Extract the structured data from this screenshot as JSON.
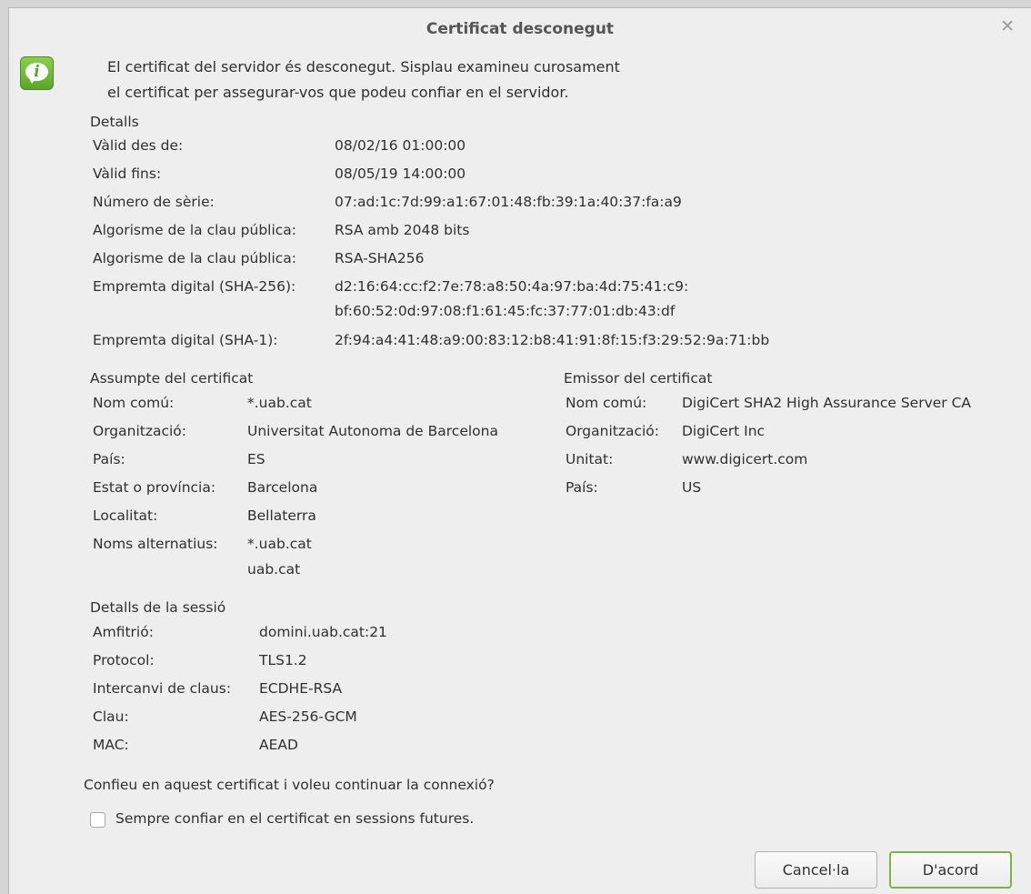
{
  "window": {
    "title": "Certificat desconegut"
  },
  "message": {
    "line1": "El certificat del servidor és desconegut. Sisplau examineu curosament",
    "line2": "el certificat per assegurar-vos que podeu confiar en el servidor."
  },
  "details": {
    "heading": "Detalls",
    "rows": [
      {
        "label": "Vàlid des de:",
        "value": "08/02/16 01:00:00"
      },
      {
        "label": "Vàlid fins:",
        "value": "08/05/19 14:00:00"
      },
      {
        "label": "Número de sèrie:",
        "value": "07:ad:1c:7d:99:a1:67:01:48:fb:39:1a:40:37:fa:a9"
      },
      {
        "label": "Algorisme de la clau pública:",
        "value": "RSA amb 2048 bits"
      },
      {
        "label": "Algorisme de la clau pública:",
        "value": "RSA-SHA256"
      },
      {
        "label": "Empremta digital (SHA-256):",
        "value": "d2:16:64:cc:f2:7e:78:a8:50:4a:97:ba:4d:75:41:c9:",
        "value2": "bf:60:52:0d:97:08:f1:61:45:fc:37:77:01:db:43:df"
      },
      {
        "label": "Empremta digital (SHA-1):",
        "value": "2f:94:a4:41:48:a9:00:83:12:b8:41:91:8f:15:f3:29:52:9a:71:bb"
      }
    ]
  },
  "subject": {
    "heading": "Assumpte del certificat",
    "rows": [
      {
        "label": "Nom comú:",
        "value": "*.uab.cat"
      },
      {
        "label": "Organització:",
        "value": "Universitat Autonoma de Barcelona"
      },
      {
        "label": "País:",
        "value": "ES"
      },
      {
        "label": "Estat o província:",
        "value": "Barcelona"
      },
      {
        "label": "Localitat:",
        "value": "Bellaterra"
      },
      {
        "label": "Noms alternatius:",
        "value": "*.uab.cat",
        "value2": "uab.cat"
      }
    ]
  },
  "issuer": {
    "heading": "Emissor del certificat",
    "rows": [
      {
        "label": "Nom comú:",
        "value": "DigiCert SHA2 High Assurance Server CA"
      },
      {
        "label": "Organització:",
        "value": "DigiCert Inc"
      },
      {
        "label": "Unitat:",
        "value": "www.digicert.com"
      },
      {
        "label": "País:",
        "value": "US"
      }
    ]
  },
  "session": {
    "heading": "Detalls de la sessió",
    "rows": [
      {
        "label": "Amfitrió:",
        "value": "domini.uab.cat:21"
      },
      {
        "label": "Protocol:",
        "value": "TLS1.2"
      },
      {
        "label": "Intercanvi de claus:",
        "value": "ECDHE-RSA"
      },
      {
        "label": "Clau:",
        "value": "AES-256-GCM"
      },
      {
        "label": "MAC:",
        "value": "AEAD"
      }
    ]
  },
  "question": "Confieu en aquest certificat i voleu continuar la connexió?",
  "always_trust": {
    "label": "Sempre confiar en el certificat en sessions futures.",
    "checked": false
  },
  "buttons": {
    "cancel": "Cancel·la",
    "ok": "D'acord"
  },
  "colors": {
    "accent": "#7cb342",
    "icon_green": "#5aa52a",
    "background": "#eeeeee"
  }
}
